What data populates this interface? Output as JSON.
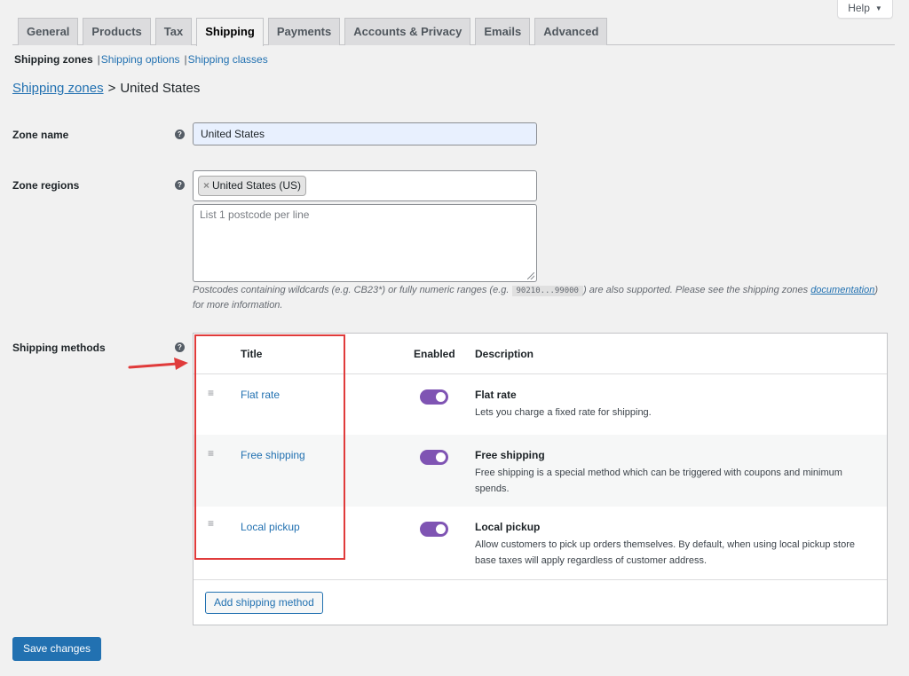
{
  "help": {
    "label": "Help",
    "caret": "▼"
  },
  "tabs": [
    {
      "label": "General"
    },
    {
      "label": "Products"
    },
    {
      "label": "Tax"
    },
    {
      "label": "Shipping"
    },
    {
      "label": "Payments"
    },
    {
      "label": "Accounts & Privacy"
    },
    {
      "label": "Emails"
    },
    {
      "label": "Advanced"
    }
  ],
  "active_tab": "Shipping",
  "subnav": {
    "current": "Shipping zones",
    "separator": "|",
    "links": [
      "Shipping options",
      "Shipping classes"
    ]
  },
  "breadcrumb": {
    "link": "Shipping zones",
    "separator": ">",
    "current": "United States"
  },
  "zone_name": {
    "label": "Zone name",
    "value": "United States"
  },
  "zone_regions": {
    "label": "Zone regions",
    "chip_remove": "×",
    "chip": "United States (US)",
    "postcode_placeholder": "List 1 postcode per line",
    "note_before": "Postcodes containing wildcards (e.g. CB23*) or fully numeric ranges (e.g. ",
    "note_code": "90210...99000",
    "note_middle": ") are also supported. Please see the shipping zones ",
    "note_link": "documentation",
    "note_after": ") for more information."
  },
  "shipping_methods": {
    "label": "Shipping methods",
    "headers": {
      "title": "Title",
      "enabled": "Enabled",
      "description": "Description"
    },
    "rows": [
      {
        "title": "Flat rate",
        "enabled": true,
        "desc_title": "Flat rate",
        "desc": "Lets you charge a fixed rate for shipping."
      },
      {
        "title": "Free shipping",
        "enabled": true,
        "desc_title": "Free shipping",
        "desc": "Free shipping is a special method which can be triggered with coupons and minimum spends."
      },
      {
        "title": "Local pickup",
        "enabled": true,
        "desc_title": "Local pickup",
        "desc": "Allow customers to pick up orders themselves. By default, when using local pickup store base taxes will apply regardless of customer address."
      }
    ],
    "add_button": "Add shipping method"
  },
  "help_icon_glyph": "?",
  "drag_icon_glyph": "≡",
  "save_button": "Save changes",
  "colors": {
    "accent": "#2271b1",
    "toggle_on": "#7f54b3",
    "annotation": "#e03b3b"
  }
}
